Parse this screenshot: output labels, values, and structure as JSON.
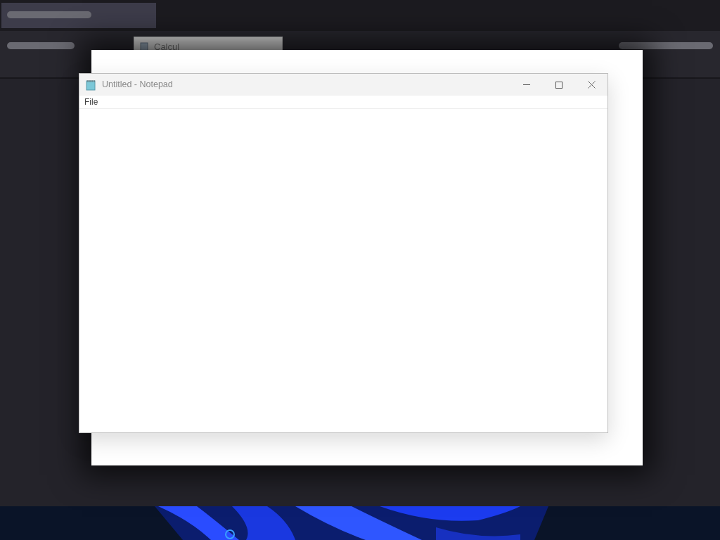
{
  "calculator_window": {
    "title": "Calcul"
  },
  "notepad_window": {
    "title": "Untitled - Notepad",
    "menu": [
      "File"
    ]
  }
}
